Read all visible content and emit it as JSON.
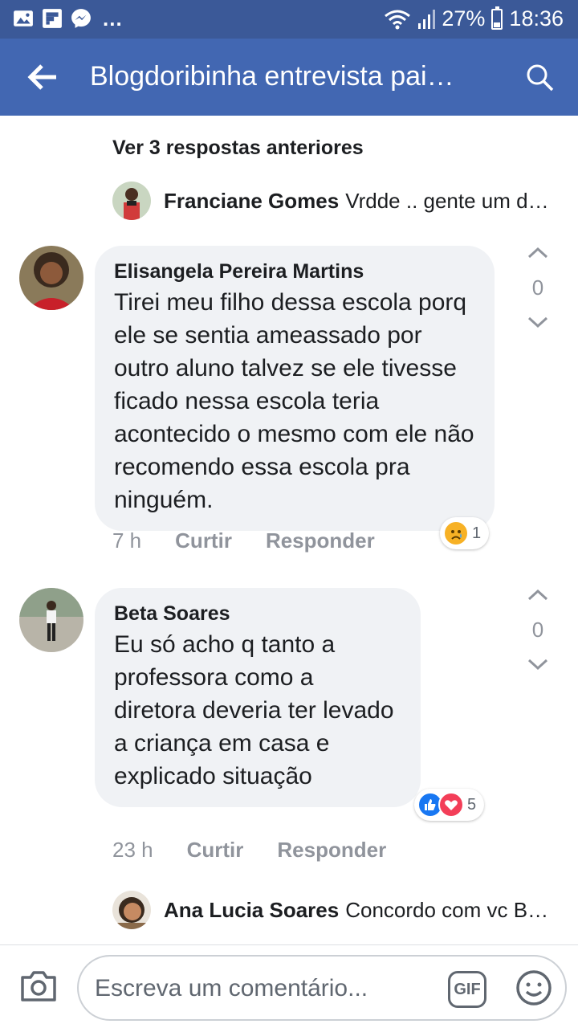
{
  "status_bar": {
    "battery_percent": "27%",
    "time": "18:36",
    "left_icons": [
      "gallery-icon",
      "flipboard-icon",
      "messenger-icon"
    ],
    "more": "..."
  },
  "app_bar": {
    "title": "Blogdoribinha entrevista pai…"
  },
  "comments": {
    "previous_replies": "Ver 3 respostas anteriores",
    "reply_top": {
      "author": "Franciane Gomes",
      "text": "Vrdde .. gente um di…"
    },
    "items": [
      {
        "author": "Elisangela Pereira Martins",
        "text": "Tirei meu filho dessa escola porq ele se sentia ameassado por outro aluno talvez se ele tivesse ficado nessa escola teria acontecido o mesmo com ele não recomendo essa escola pra ninguém.",
        "time": "7 h",
        "like_label": "Curtir",
        "reply_label": "Responder",
        "reaction_count": "1",
        "reactions": [
          "sad"
        ],
        "score": "0"
      },
      {
        "author": "Beta Soares",
        "text": "Eu só acho q tanto a professora como a diretora deveria ter levado a criança em casa e explicado situação",
        "time": "23 h",
        "like_label": "Curtir",
        "reply_label": "Responder",
        "reaction_count": "5",
        "reactions": [
          "like",
          "love"
        ],
        "score": "0"
      }
    ],
    "reply_bottom": {
      "author": "Ana Lucia Soares",
      "text": "Concordo com vc B…"
    }
  },
  "composer": {
    "placeholder": "Escreva um comentário...",
    "gif_label": "GIF"
  },
  "colors": {
    "status_bar": "#3b5998",
    "app_bar": "#4267b2",
    "bubble": "#f0f2f5",
    "like": "#1877f2",
    "love": "#f33e58",
    "sad": "#f7b125"
  }
}
